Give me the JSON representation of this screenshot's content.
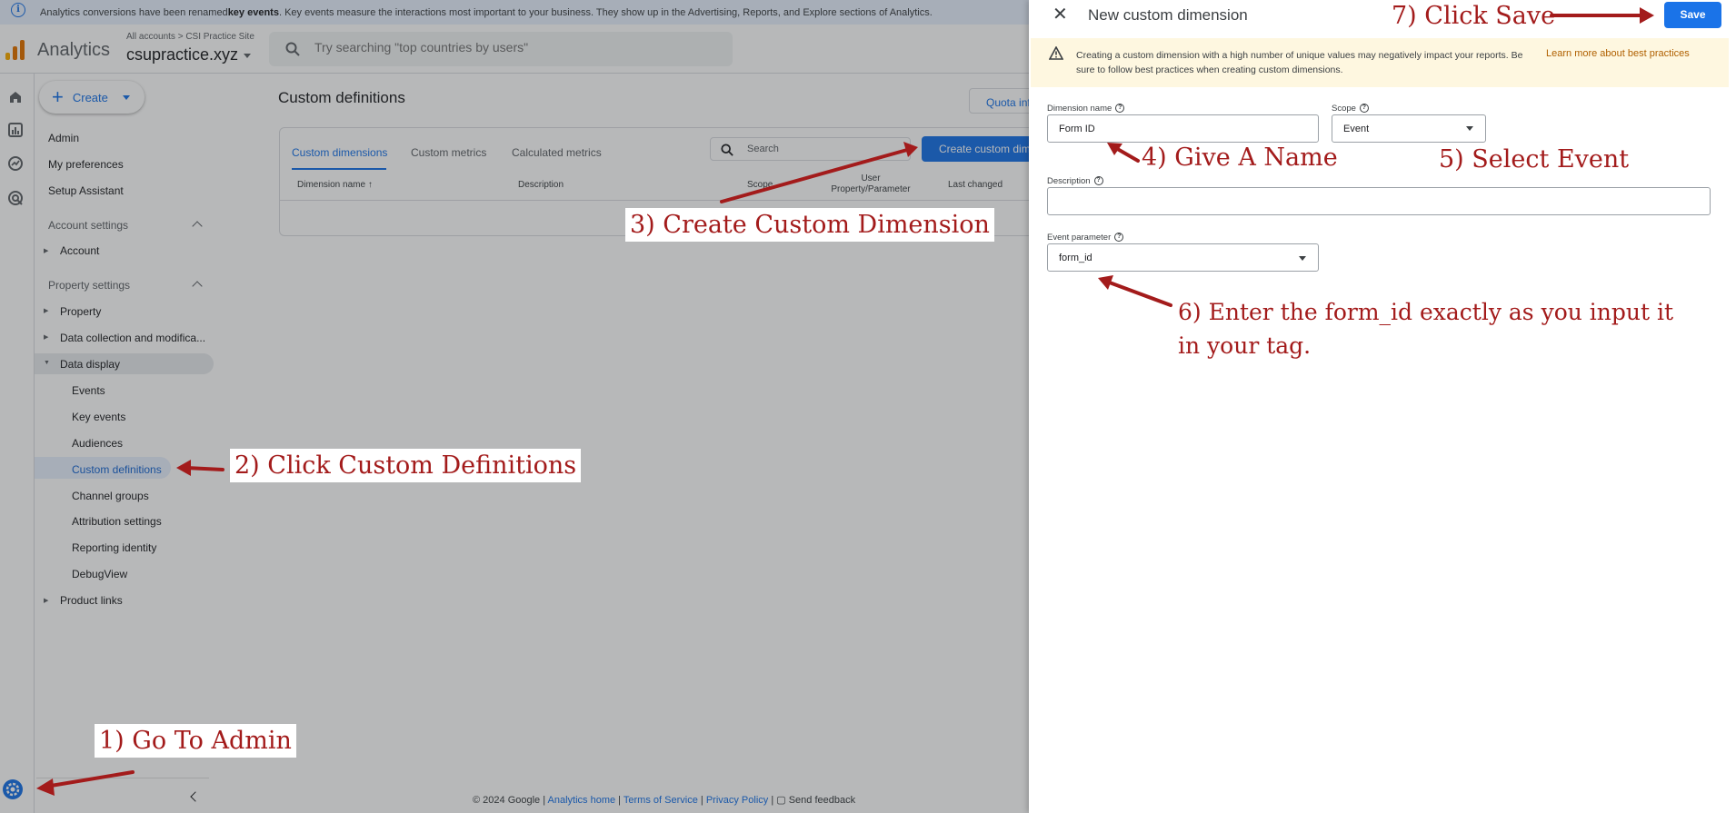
{
  "banner": {
    "pre": "Analytics conversions have been renamed ",
    "bold": "key events",
    "post": ". Key events measure the interactions most important to your business. They show up in the Advertising, Reports, and Explore sections of Analytics."
  },
  "header": {
    "app_name": "Analytics",
    "breadcrumb": "All accounts > CSI Practice Site",
    "property": "csupractice.xyz",
    "search_placeholder": "Try searching \"top countries by users\""
  },
  "left_nav": {
    "create_label": "Create",
    "admin": "Admin",
    "my_preferences": "My preferences",
    "setup_assistant": "Setup Assistant",
    "account_settings": "Account settings",
    "account": "Account",
    "property_settings": "Property settings",
    "property": "Property",
    "data_collection": "Data collection and modifica...",
    "data_display": "Data display",
    "sub_items": [
      "Events",
      "Key events",
      "Audiences",
      "Custom definitions",
      "Channel groups",
      "Attribution settings",
      "Reporting identity",
      "DebugView"
    ],
    "product_links": "Product links"
  },
  "main": {
    "title": "Custom definitions",
    "quota_label": "Quota inf",
    "tabs": [
      "Custom dimensions",
      "Custom metrics",
      "Calculated metrics"
    ],
    "search_placeholder": "Search",
    "create_button": "Create custom dim",
    "columns": [
      "Dimension name",
      "Description",
      "Scope",
      "User Property/Parameter",
      "Last changed"
    ]
  },
  "footer": {
    "copyright": "© 2024 Google | ",
    "analytics_home": "Analytics home",
    "sep1": " | ",
    "terms": "Terms of Service",
    "sep2": " | ",
    "privacy": "Privacy Policy",
    "sep3": " | ",
    "feedback": "Send feedback"
  },
  "panel": {
    "title": "New custom dimension",
    "save_label": "Save",
    "warning_text": "Creating a custom dimension with a high number of unique values may negatively impact your reports. Be sure to follow best practices when creating custom dimensions.",
    "warning_link": "Learn more about best practices",
    "dimension_name_label": "Dimension name",
    "dimension_name_value": "Form ID",
    "scope_label": "Scope",
    "scope_value": "Event",
    "description_label": "Description",
    "description_value": "",
    "event_parameter_label": "Event parameter",
    "event_parameter_value": "form_id"
  },
  "annotations": {
    "step1": "1) Go To Admin",
    "step2": "2) Click Custom Definitions",
    "step3": "3) Create Custom Dimension",
    "step4": "4) Give A Name",
    "step5": "5) Select Event",
    "step6": "6) Enter the form_id exactly as you input it in your tag.",
    "step7": "7) Click Save"
  },
  "colors": {
    "accent": "#1a73e8",
    "annotation": "#a31b1b",
    "warning_bg": "#fef7e0",
    "banner_bg": "#e8f0fe"
  }
}
